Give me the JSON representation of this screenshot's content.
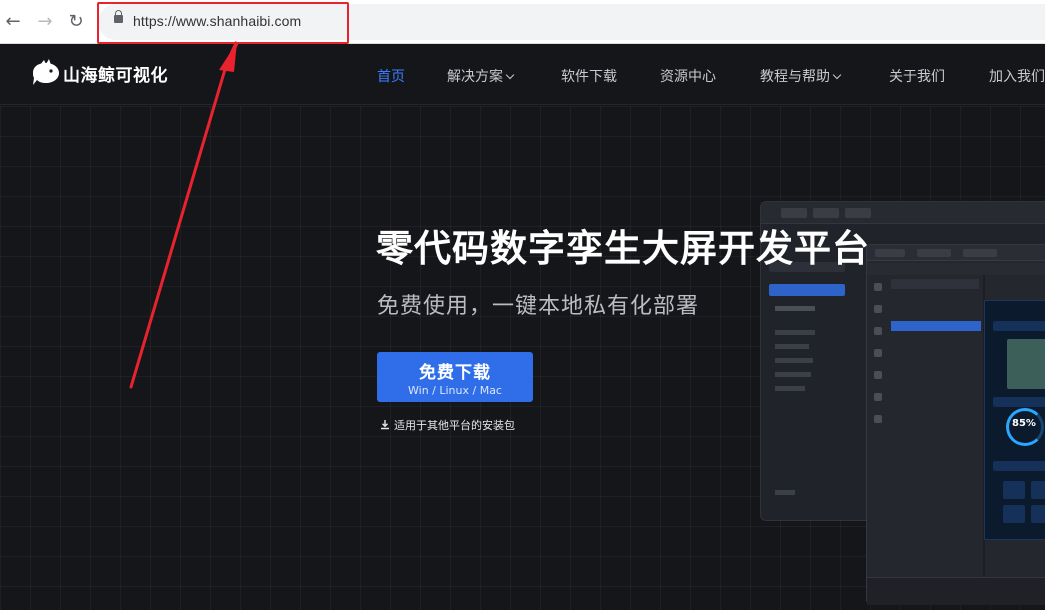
{
  "browser": {
    "url": "https://www.shanhaibi.com"
  },
  "site": {
    "logo_text": "山海鲸可视化",
    "nav": [
      {
        "label": "首页",
        "active": true,
        "has_dropdown": false
      },
      {
        "label": "解决方案",
        "active": false,
        "has_dropdown": true
      },
      {
        "label": "软件下载",
        "active": false,
        "has_dropdown": false
      },
      {
        "label": "资源中心",
        "active": false,
        "has_dropdown": false
      },
      {
        "label": "教程与帮助",
        "active": false,
        "has_dropdown": true
      },
      {
        "label": "关于我们",
        "active": false,
        "has_dropdown": false
      },
      {
        "label": "加入我们",
        "active": false,
        "has_dropdown": false
      }
    ]
  },
  "hero": {
    "title": "零代码数字孪生大屏开发平台",
    "subtitle": "免费使用，一键本地私有化部署",
    "download_button": {
      "label": "免费下载",
      "platforms": "Win / Linux / Mac"
    },
    "other_platforms_link": "适用于其他平台的安装包"
  },
  "mock": {
    "ring_value": "85%"
  },
  "colors": {
    "accent": "#3b7dff",
    "button": "#2f6ee8",
    "highlight": "#e8232d"
  }
}
